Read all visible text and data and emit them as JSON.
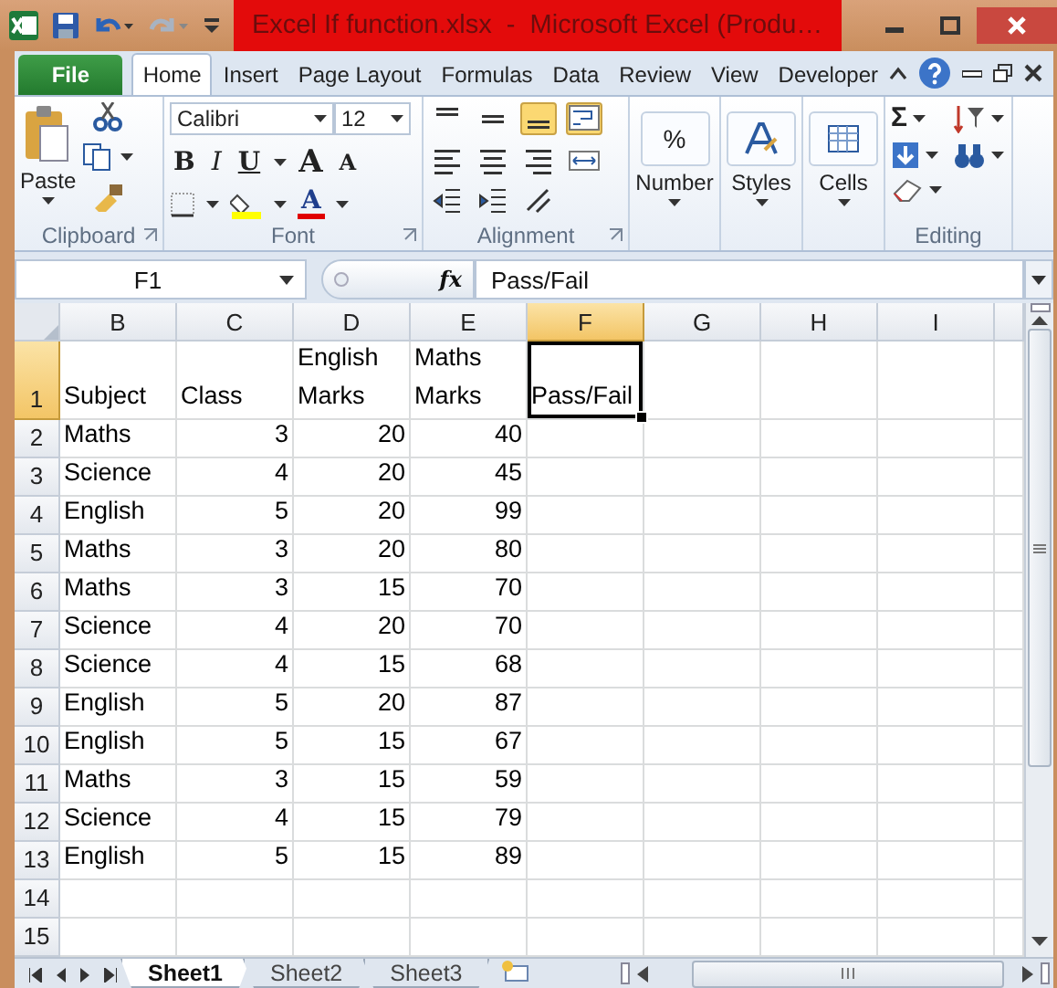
{
  "window": {
    "title": "Excel If function.xlsx  -  Microsoft Excel (Produ…"
  },
  "ribbon_tabs": [
    {
      "label": "File",
      "kind": "file",
      "selected": false
    },
    {
      "label": "Home",
      "kind": "tab",
      "selected": true
    },
    {
      "label": "Insert",
      "kind": "tab",
      "selected": false
    },
    {
      "label": "Page Layout",
      "kind": "tab",
      "selected": false
    },
    {
      "label": "Formulas",
      "kind": "tab",
      "selected": false
    },
    {
      "label": "Data",
      "kind": "tab",
      "selected": false
    },
    {
      "label": "Review",
      "kind": "tab",
      "selected": false
    },
    {
      "label": "View",
      "kind": "tab",
      "selected": false
    },
    {
      "label": "Developer",
      "kind": "tab",
      "selected": false
    }
  ],
  "clipboard": {
    "paste": "Paste",
    "label": "Clipboard"
  },
  "font": {
    "name": "Calibri",
    "size": "12",
    "bold": "B",
    "italic": "I",
    "underline": "U",
    "grow": "A",
    "shrink": "A",
    "color_button": "A",
    "label": "Font"
  },
  "alignment": {
    "label": "Alignment",
    "buttons": [
      {
        "kind": "top",
        "selected": false
      },
      {
        "kind": "middle",
        "selected": false
      },
      {
        "kind": "bottom",
        "selected": true
      },
      {
        "kind": "wrap",
        "selected": true
      },
      {
        "kind": "left",
        "selected": false
      },
      {
        "kind": "center",
        "selected": false
      },
      {
        "kind": "right",
        "selected": false
      },
      {
        "kind": "merge",
        "selected": false
      },
      {
        "kind": "outdent",
        "selected": false
      },
      {
        "kind": "indent",
        "selected": false
      },
      {
        "kind": "orientation",
        "selected": false
      }
    ]
  },
  "number": {
    "symbol": "%",
    "label": "Number"
  },
  "styles": {
    "label": "Styles"
  },
  "cells": {
    "label": "Cells"
  },
  "editing": {
    "sum": "Σ",
    "label": "Editing"
  },
  "formula_bar": {
    "name_box": "F1",
    "fx": "fx",
    "formula": "Pass/Fail"
  },
  "sheet": {
    "columns": [
      {
        "label": "B",
        "kind": "text",
        "selected": false
      },
      {
        "label": "C",
        "kind": "number",
        "selected": false
      },
      {
        "label": "D",
        "kind": "number",
        "selected": false
      },
      {
        "label": "E",
        "kind": "number",
        "selected": false
      },
      {
        "label": "F",
        "kind": "text",
        "selected": true
      },
      {
        "label": "G",
        "kind": "text",
        "selected": false
      },
      {
        "label": "H",
        "kind": "text",
        "selected": false
      },
      {
        "label": "I",
        "kind": "text",
        "selected": false
      }
    ],
    "rows": [
      {
        "label": "1",
        "kind": "header",
        "selected": true,
        "cells": [
          "Subject",
          "Class",
          "English Marks",
          "Maths Marks",
          "Pass/Fail"
        ]
      },
      {
        "label": "2",
        "kind": "data",
        "selected": false,
        "cells": [
          "Maths",
          "3",
          "20",
          "40"
        ]
      },
      {
        "label": "3",
        "kind": "data",
        "selected": false,
        "cells": [
          "Science",
          "4",
          "20",
          "45"
        ]
      },
      {
        "label": "4",
        "kind": "data",
        "selected": false,
        "cells": [
          "English",
          "5",
          "20",
          "99"
        ]
      },
      {
        "label": "5",
        "kind": "data",
        "selected": false,
        "cells": [
          "Maths",
          "3",
          "20",
          "80"
        ]
      },
      {
        "label": "6",
        "kind": "data",
        "selected": false,
        "cells": [
          "Maths",
          "3",
          "15",
          "70"
        ]
      },
      {
        "label": "7",
        "kind": "data",
        "selected": false,
        "cells": [
          "Science",
          "4",
          "20",
          "70"
        ]
      },
      {
        "label": "8",
        "kind": "data",
        "selected": false,
        "cells": [
          "Science",
          "4",
          "15",
          "68"
        ]
      },
      {
        "label": "9",
        "kind": "data",
        "selected": false,
        "cells": [
          "English",
          "5",
          "20",
          "87"
        ]
      },
      {
        "label": "10",
        "kind": "data",
        "selected": false,
        "cells": [
          "English",
          "5",
          "15",
          "67"
        ]
      },
      {
        "label": "11",
        "kind": "data",
        "selected": false,
        "cells": [
          "Maths",
          "3",
          "15",
          "59"
        ]
      },
      {
        "label": "12",
        "kind": "data",
        "selected": false,
        "cells": [
          "Science",
          "4",
          "15",
          "79"
        ]
      },
      {
        "label": "13",
        "kind": "data",
        "selected": false,
        "cells": [
          "English",
          "5",
          "15",
          "89"
        ]
      },
      {
        "label": "14",
        "kind": "data",
        "selected": false
      },
      {
        "label": "15",
        "kind": "data",
        "selected": false
      }
    ]
  },
  "sheet_tabs": [
    {
      "label": "Sheet1",
      "selected": true
    },
    {
      "label": "Sheet2",
      "selected": false
    },
    {
      "label": "Sheet3",
      "selected": false
    }
  ]
}
